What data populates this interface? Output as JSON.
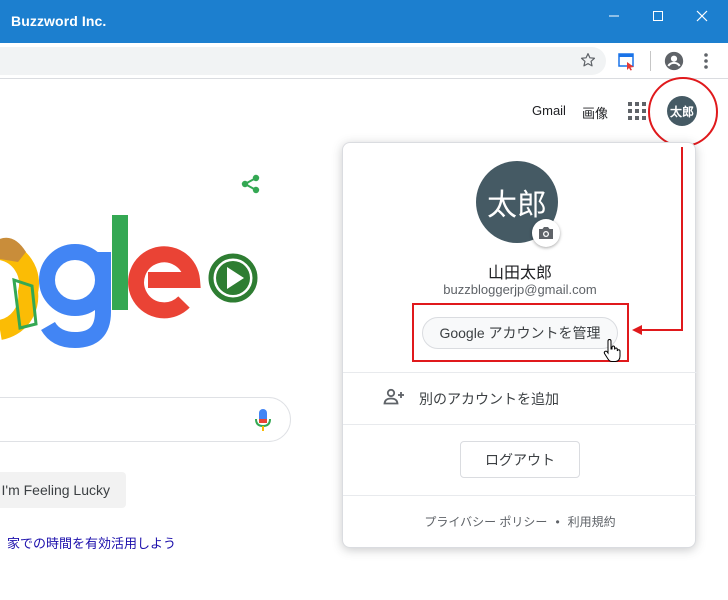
{
  "window": {
    "title": "Buzzword Inc."
  },
  "header": {
    "gmail": "Gmail",
    "images": "画像",
    "avatar_text": "太郎"
  },
  "search": {
    "lucky_label": "I'm Feeling Lucky",
    "promo_text": "家での時間を有効活用しよう"
  },
  "account_popup": {
    "avatar_text": "太郎",
    "name": "山田太郎",
    "email": "buzzbloggerjp@gmail.com",
    "manage_label": "Google アカウントを管理",
    "add_account_label": "別のアカウントを追加",
    "logout_label": "ログアウト",
    "privacy_label": "プライバシー ポリシー",
    "separator": "•",
    "terms_label": "利用規約"
  },
  "colors": {
    "titlebar": "#1c7fcf",
    "avatar": "#455a64",
    "annotation_red": "#e0191c",
    "google_blue": "#4285f4",
    "google_red": "#ea4335",
    "google_yellow": "#fbbc05",
    "google_green": "#34a853"
  }
}
